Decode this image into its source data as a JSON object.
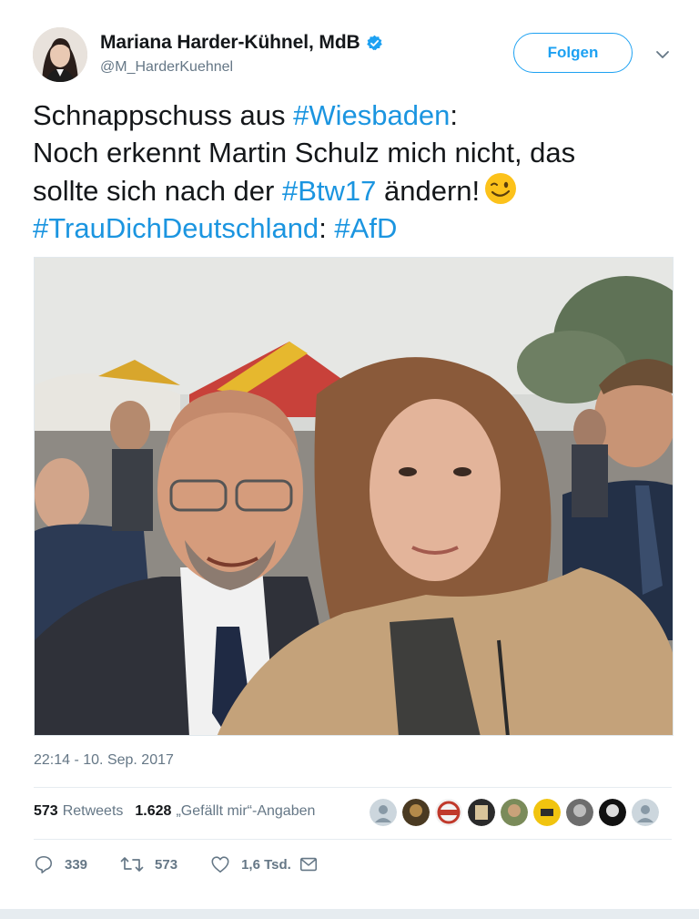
{
  "author": {
    "name": "Mariana Harder-Kühnel, MdB",
    "handle": "@M_HarderKuehnel",
    "verified": true,
    "avatar_icon": "profile-photo"
  },
  "follow_button": {
    "label": "Folgen"
  },
  "menu_icon": "chevron-down-icon",
  "tweet": {
    "line1_text": "Schnappschuss aus ",
    "line1_tag": "#Wiesbaden",
    "line1_suffix": ":",
    "line2_text": "Noch erkennt Martin Schulz mich nicht, das",
    "line3_text": "sollte sich nach der ",
    "line3_tag": "#Btw17",
    "line3_suffix": " ändern!",
    "emoji": "winking-face",
    "line4_tag1": "#TrauDichDeutschland",
    "line4_sep": ": ",
    "line4_tag2": "#AfD"
  },
  "photo": {
    "kind": "selfie-photo"
  },
  "timestamp": "22:14 - 10. Sep. 2017",
  "stats": {
    "retweets_count": "573",
    "retweets_label": "Retweets",
    "likes_count": "1.628",
    "likes_label": "„Gefällt mir“-Angaben"
  },
  "likers": [
    "avatar-default",
    "avatar-photo",
    "avatar-badge-red",
    "avatar-photo",
    "avatar-photo",
    "avatar-yellow",
    "avatar-photo",
    "avatar-photo-bw",
    "avatar-default"
  ],
  "actions": {
    "reply_count": "339",
    "retweet_count": "573",
    "like_count": "1,6 Tsd."
  },
  "colors": {
    "link": "#1b95e0",
    "follow": "#1da1f2",
    "muted": "#657786",
    "text": "#14171a"
  }
}
